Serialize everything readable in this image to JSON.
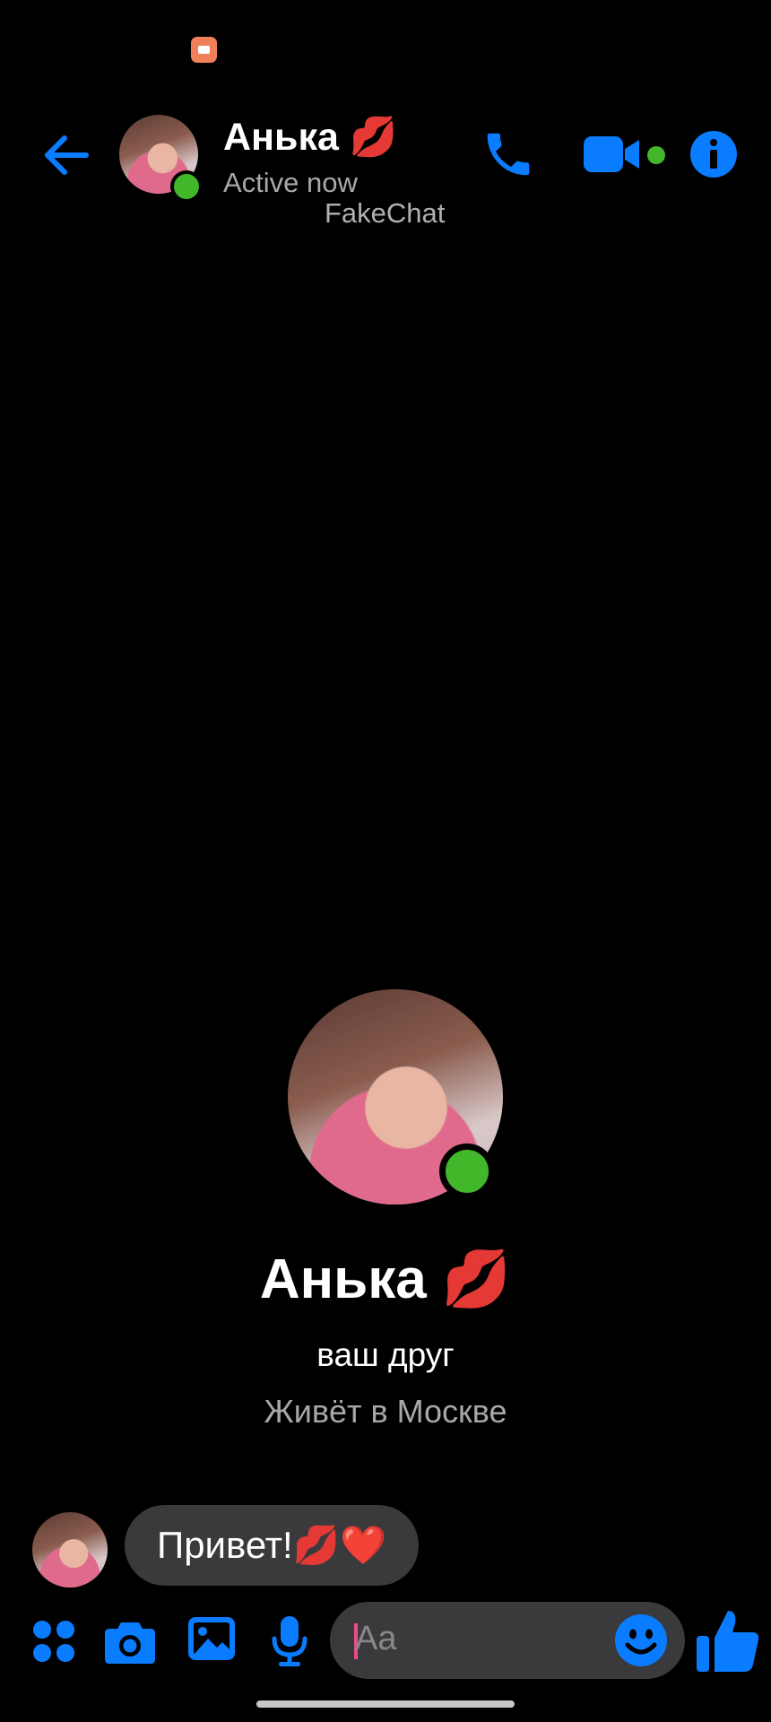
{
  "status_bar": {
    "app_icon": "orange-app-icon"
  },
  "header": {
    "back_icon": "arrow-left-icon",
    "contact_name": "Анька 💋",
    "status": "Active now",
    "watermark": "FakeChat",
    "call_icon": "phone-icon",
    "video_icon": "video-camera-icon",
    "info_icon": "info-icon"
  },
  "profile": {
    "name": "Анька 💋",
    "relation": "ваш друг",
    "location": "Живёт в Москве"
  },
  "messages": [
    {
      "sender": "Анька",
      "text": "Привет!💋❤️"
    }
  ],
  "composer": {
    "placeholder": "Aa",
    "icons": [
      "apps-icon",
      "camera-icon",
      "gallery-icon",
      "microphone-icon",
      "emoji-icon",
      "thumbs-up-icon"
    ]
  },
  "colors": {
    "accent": "#0a7cff",
    "online": "#42b72a",
    "bubble": "#3a3a3c",
    "background": "#000000"
  }
}
